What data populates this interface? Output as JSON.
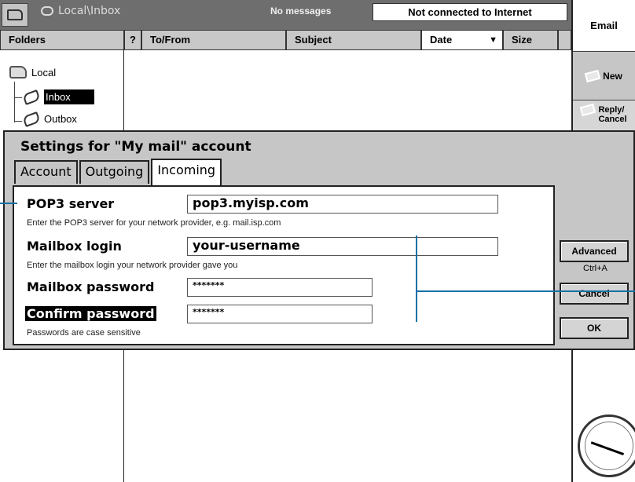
{
  "titlebar": {
    "location": "Local\\Inbox",
    "message_count": "No messages",
    "connection_status": "Not connected to Internet"
  },
  "columns": {
    "folders": "Folders",
    "flag": "?",
    "to_from": "To/From",
    "subject": "Subject",
    "date": "Date",
    "size": "Size"
  },
  "folders": {
    "root": "Local",
    "items": [
      "Inbox",
      "Outbox"
    ],
    "selected": "Inbox"
  },
  "toolbar": {
    "email": "Email",
    "new": "New",
    "reply": "Reply/\nCancel"
  },
  "dialog": {
    "title": "Settings for \"My mail\" account",
    "tabs": [
      "Account",
      "Outgoing",
      "Incoming"
    ],
    "active_tab": "Incoming",
    "fields": {
      "pop3_label": "POP3 server",
      "pop3_value": "pop3.myisp.com",
      "pop3_hint": "Enter the POP3 server for your network provider, e.g. mail.isp.com",
      "login_label": "Mailbox login",
      "login_value": "your-username",
      "login_hint": "Enter the mailbox login your network provider gave you",
      "password_label": "Mailbox password",
      "password_value": "*******",
      "confirm_label": "Confirm password",
      "confirm_value": "*******",
      "password_hint": "Passwords are case sensitive"
    },
    "buttons": {
      "advanced": "Advanced",
      "advanced_shortcut": "Ctrl+A",
      "cancel": "Cancel",
      "ok": "OK"
    }
  },
  "colors": {
    "titlebar_bg": "#6e6e6e",
    "dialog_bg": "#c6c6c6",
    "annotation_line": "#1670a6"
  },
  "icons": [
    "folder-icon",
    "location-icon",
    "folder-local-icon",
    "mailbox-icon",
    "envelope-icon",
    "clock-icon"
  ]
}
